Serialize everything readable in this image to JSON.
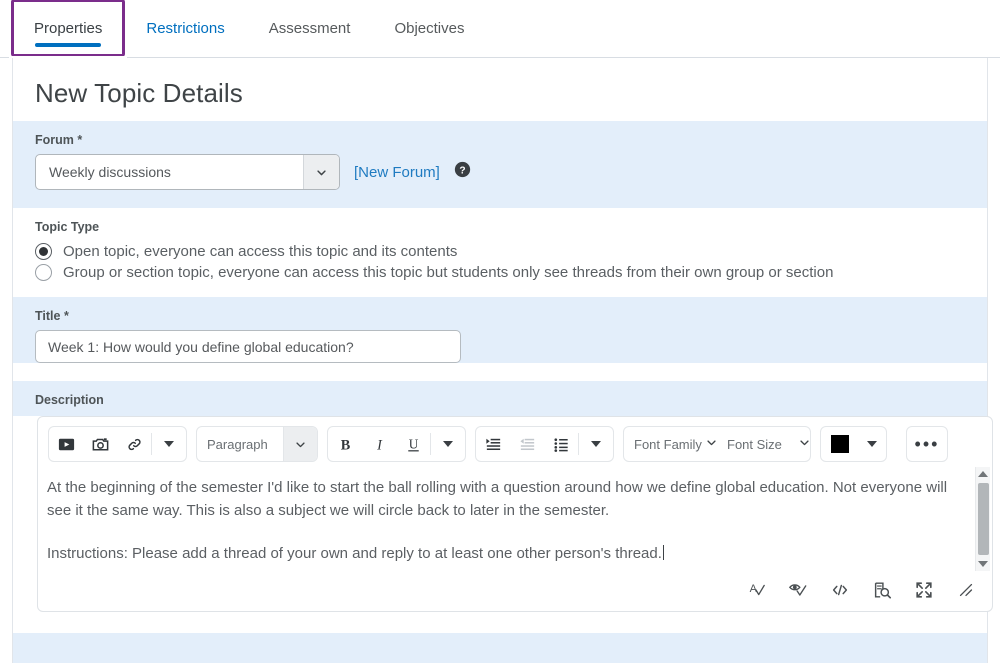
{
  "tabs": [
    {
      "label": "Properties",
      "state": "selected-focused"
    },
    {
      "label": "Restrictions",
      "state": "link"
    },
    {
      "label": "Assessment",
      "state": "normal"
    },
    {
      "label": "Objectives",
      "state": "normal"
    }
  ],
  "page": {
    "title": "New Topic Details"
  },
  "forum": {
    "label": "Forum",
    "required_mark": "*",
    "selected_value": "Weekly discussions",
    "new_forum_link": "[New Forum]",
    "help_icon": "help-circle-icon",
    "chevron_icon": "chevron-down-icon"
  },
  "topic_type": {
    "label": "Topic Type",
    "options": [
      {
        "label": "Open topic, everyone can access this topic and its contents",
        "selected": true
      },
      {
        "label": "Group or section topic, everyone can access this topic but students only see threads from their own group or section",
        "selected": false
      }
    ]
  },
  "title_field": {
    "label": "Title",
    "required_mark": "*",
    "value": "Week 1: How would you define global education?",
    "placeholder": "Title"
  },
  "description": {
    "label": "Description",
    "toolbar": {
      "group1": [
        {
          "name": "insert-video-icon",
          "label": "Insert Stuff"
        },
        {
          "name": "insert-image-icon",
          "label": "Insert Image"
        },
        {
          "name": "insert-link-icon",
          "label": "Insert Quicklink"
        },
        {
          "name": "chevron-down-icon",
          "label": "More insert options"
        }
      ],
      "format_select": {
        "value": "Paragraph",
        "caret": "chevron-down-icon"
      },
      "group2": [
        {
          "name": "bold-icon",
          "label": "B"
        },
        {
          "name": "italic-icon",
          "label": "I"
        },
        {
          "name": "underline-icon",
          "label": "U"
        },
        {
          "name": "chevron-down-icon",
          "label": "More text styles"
        }
      ],
      "group3": [
        {
          "name": "indent-increase-icon",
          "label": "Increase indent"
        },
        {
          "name": "indent-decrease-icon",
          "label": "Decrease indent"
        },
        {
          "name": "bulleted-list-icon",
          "label": "Bulleted list"
        },
        {
          "name": "chevron-down-icon",
          "label": "More list options"
        }
      ],
      "font_family": {
        "value": "Font Family",
        "caret": "chevron-down-icon"
      },
      "font_size": {
        "value": "Font Size",
        "caret": "chevron-down-icon"
      },
      "color_picker": {
        "color": "#000000",
        "caret": "caret-down-icon"
      },
      "overflow": {
        "label": "•••",
        "name": "more-options-icon"
      }
    },
    "content": {
      "paragraph1": "At the beginning of the semester I'd like to start the ball rolling with a question around how we define global education. Not everyone will see it the same way. This is also a subject we will circle back to later in the semester.",
      "paragraph2": "Instructions: Please add a thread of your own and reply to at least one other person's thread."
    },
    "footer_icons": [
      {
        "name": "spellcheck-icon",
        "label": "Check spelling"
      },
      {
        "name": "accessibility-check-icon",
        "label": "Accessibility checker"
      },
      {
        "name": "html-source-icon",
        "label": "HTML source editor"
      },
      {
        "name": "preview-icon",
        "label": "Preview"
      },
      {
        "name": "fullscreen-icon",
        "label": "Toggle fullscreen"
      },
      {
        "name": "resize-handle-icon",
        "label": "Resize"
      }
    ],
    "scrollbar": {
      "up_arrow": "scroll-up-arrow-icon",
      "down_arrow": "scroll-down-arrow-icon"
    }
  },
  "colors": {
    "accent_blue": "#006fbf",
    "link_blue": "#1f7bc1",
    "focus_purple": "#7b2d8b",
    "band_blue": "#e3eefa",
    "text_gray": "#5a5f63"
  }
}
